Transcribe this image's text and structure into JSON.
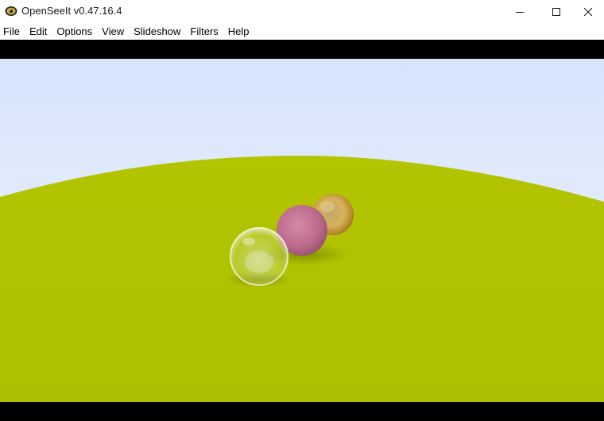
{
  "window": {
    "title": "OpenSeeIt v0.47.16.4",
    "app_icon": "openseeit-app-icon"
  },
  "window_controls": {
    "minimize_icon": "minimize-icon",
    "maximize_icon": "maximize-icon",
    "close_icon": "close-icon"
  },
  "menu": {
    "items": [
      {
        "label": "File"
      },
      {
        "label": "Edit"
      },
      {
        "label": "Options"
      },
      {
        "label": "View"
      },
      {
        "label": "Slideshow"
      },
      {
        "label": "Filters"
      },
      {
        "label": "Help"
      }
    ]
  },
  "image": {
    "colors": {
      "sky_top": "#d6e3fb",
      "sky_horizon": "#f3f7ff",
      "ground": "#b0c200",
      "pink_sphere": "#c06a8a",
      "gold_sphere": "#c9a85a",
      "glass_sphere": "#dfe9d0",
      "letterbox": "#000000"
    }
  }
}
